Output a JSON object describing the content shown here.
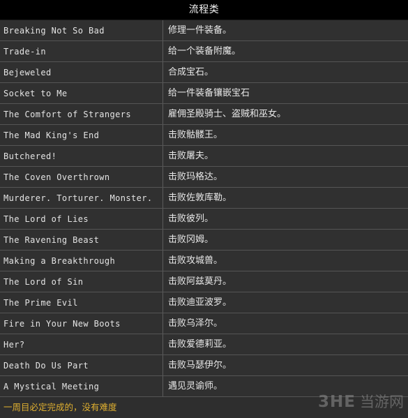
{
  "header": {
    "title": "流程类"
  },
  "table": {
    "rows": [
      {
        "name": "Breaking Not So Bad",
        "desc": "修理一件装备。"
      },
      {
        "name": "Trade-in",
        "desc": "给一个装备附魔。"
      },
      {
        "name": "Bejeweled",
        "desc": "合成宝石。"
      },
      {
        "name": "Socket to Me",
        "desc": "给一件装备镶嵌宝石"
      },
      {
        "name": "The Comfort of Strangers",
        "desc": "雇佣圣殿骑士、盗贼和巫女。"
      },
      {
        "name": "The Mad King's End",
        "desc": "击败骷髅王。"
      },
      {
        "name": "Butchered!",
        "desc": "击败屠夫。"
      },
      {
        "name": "The Coven Overthrown",
        "desc": "击败玛格达。"
      },
      {
        "name": "Murderer. Torturer. Monster.",
        "desc": "击败佐敦库勒。"
      },
      {
        "name": "The Lord of Lies",
        "desc": "击败彼列。"
      },
      {
        "name": "The Ravening Beast",
        "desc": "击败冈姆。"
      },
      {
        "name": "Making a Breakthrough",
        "desc": "击败攻城兽。"
      },
      {
        "name": "The Lord of Sin",
        "desc": "击败阿兹莫丹。"
      },
      {
        "name": "The Prime Evil",
        "desc": "击败迪亚波罗。"
      },
      {
        "name": "Fire in Your New Boots",
        "desc": "击败乌泽尔。"
      },
      {
        "name": "Her?",
        "desc": "击败爱德莉亚。"
      },
      {
        "name": "Death Do Us Part",
        "desc": "击败马瑟伊尔。"
      },
      {
        "name": "A Mystical Meeting",
        "desc": "遇见灵谕师。"
      }
    ]
  },
  "footer": {
    "note": "一周目必定完成的，没有难度",
    "watermark_mark": "3HE",
    "watermark_text": "当游网"
  },
  "colors": {
    "header_bg": "#000000",
    "row_bg": "#303030",
    "row_border": "#555555",
    "text": "#e4e4e4",
    "note": "#e0b030",
    "watermark": "#8f8f8f"
  }
}
